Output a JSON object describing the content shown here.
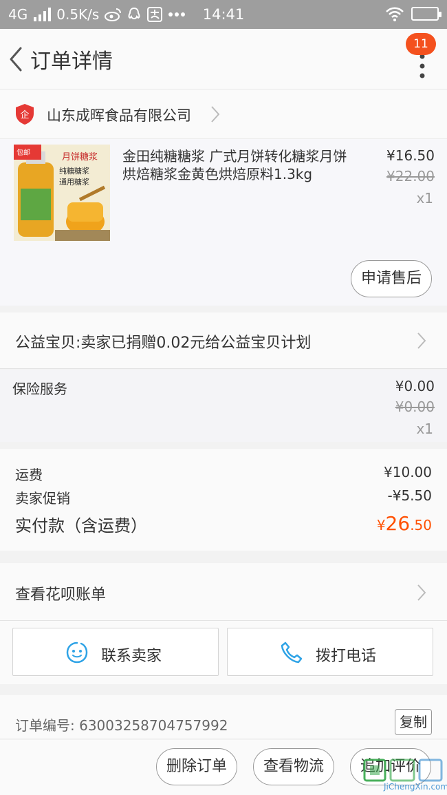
{
  "status_bar": {
    "network": "4G",
    "speed": "0.5K/s",
    "time": "14:41"
  },
  "header": {
    "title": "订单详情",
    "badge_count": "11"
  },
  "shop": {
    "logo_text": "企",
    "name": "山东成晖食品有限公司"
  },
  "product": {
    "image_tag": "包邮",
    "image_label_1": "月饼糖浆",
    "image_label_2": "纯糖糖浆",
    "image_label_3": "通用糖浆",
    "title": "金田纯糖糖浆 广式月饼转化糖浆月饼烘焙糖浆金黄色烘焙原料1.3kg",
    "price": "¥16.50",
    "original_price": "¥22.00",
    "quantity": "x1",
    "after_sale_label": "申请售后"
  },
  "charity": {
    "text": "公益宝贝:卖家已捐赠0.02元给公益宝贝计划"
  },
  "insurance": {
    "label": "保险服务",
    "price": "¥0.00",
    "original_price": "¥0.00",
    "quantity": "x1"
  },
  "summary": {
    "shipping_label": "运费",
    "shipping_value": "¥10.00",
    "promo_label": "卖家促销",
    "promo_value": "-¥5.50",
    "total_label": "实付款（含运费）",
    "total_currency": "¥",
    "total_integer": "26",
    "total_decimal": ".50"
  },
  "huabei": {
    "text": "查看花呗账单"
  },
  "contact": {
    "seller_label": "联系卖家",
    "phone_label": "拨打电话"
  },
  "order": {
    "number_text": "订单编号: 63003258704757992",
    "copy_label": "复制"
  },
  "actions": {
    "delete_label": "删除订单",
    "logistics_label": "查看物流",
    "review_label": "追加评价"
  },
  "watermark": {
    "site": "JiChengXin.com"
  },
  "colors": {
    "accent": "#ff5000",
    "badge": "#f4511e",
    "status_bar": "#9e9e9e",
    "contact_icon": "#2fa3e6"
  }
}
